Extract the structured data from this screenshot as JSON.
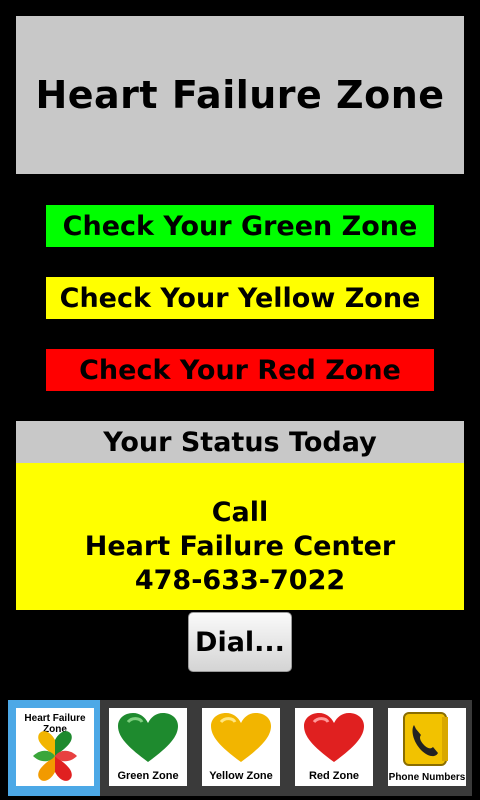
{
  "title": "Heart Failure Zone",
  "zones": {
    "green_label": "Check Your Green Zone",
    "yellow_label": "Check Your Yellow Zone",
    "red_label": "Check Your Red Zone"
  },
  "status": {
    "header": "Your Status Today",
    "line1": "Call",
    "line2": "Heart Failure Center",
    "phone": "478-633-7022",
    "color": "#ffff00"
  },
  "dial_button": "Dial...",
  "tabs": [
    {
      "label": "Heart Failure Zone",
      "icon": "multi-heart-logo-icon",
      "selected": true
    },
    {
      "label": "Green Zone",
      "icon": "green-heart-icon",
      "color": "#1e8a2e"
    },
    {
      "label": "Yellow Zone",
      "icon": "yellow-heart-icon",
      "color": "#f2b500"
    },
    {
      "label": "Red Zone",
      "icon": "red-heart-icon",
      "color": "#e02020"
    },
    {
      "label": "Phone Numbers",
      "icon": "phone-book-icon"
    }
  ],
  "colors": {
    "green": "#00ff00",
    "yellow": "#ffff00",
    "red": "#ff0000",
    "header_gray": "#c8c8c8",
    "tab_selected": "#4ca8e6"
  }
}
